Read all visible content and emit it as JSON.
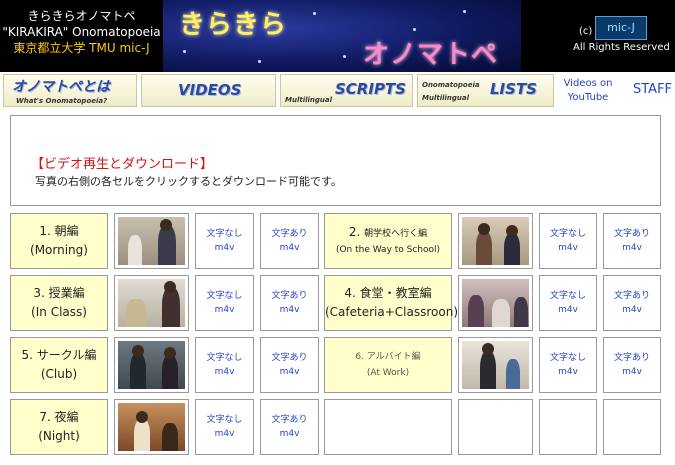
{
  "header": {
    "brand_line1": "きらきらオノマトペ",
    "brand_line2": "\"KIRAKIRA\" Onomatopoeia",
    "brand_line3": "東京都立大学 TMU mic-J",
    "banner_title1": "きらきら",
    "banner_title2": "オノマトペ",
    "copyright_symbol": "(c)",
    "logo_text": "mic-J",
    "rights": "All Rights Reserved"
  },
  "nav": {
    "about_label": "オノマトペとは",
    "about_sub": "What's Onomatopoeia?",
    "videos_label": "VIDEOS",
    "scripts_sub": "Multilingual",
    "scripts_label": "SCRIPTS",
    "lists_sub1": "Onomatopoeia",
    "lists_sub2": "Multilingual",
    "lists_label": "LISTS",
    "videos_on_youtube_1": "Videos on",
    "videos_on_youtube_2": "YouTube",
    "staff_label": "STAFF"
  },
  "info": {
    "title": "【ビデオ再生とダウンロード】",
    "desc": "写真の右側の各セルをクリックするとダウンロード可能です。"
  },
  "download": {
    "no_subs": "文字なし",
    "with_subs": "文字あり",
    "format": "m4v"
  },
  "videos": [
    {
      "label": "1. 朝編",
      "sub": "(Morning)"
    },
    {
      "label": "2. 朝学校へ行く編",
      "sub": "(On the Way to School)"
    },
    {
      "label": "3. 授業編",
      "sub": "(In Class)"
    },
    {
      "label": "4. 食堂・教室編",
      "sub": "(Cafeteria+Classroon)"
    },
    {
      "label": "5. サークル編",
      "sub": "(Club)"
    },
    {
      "label": "6. アルバイト編",
      "sub": "(At Work)"
    },
    {
      "label": "7. 夜編",
      "sub": "(Night)"
    }
  ]
}
